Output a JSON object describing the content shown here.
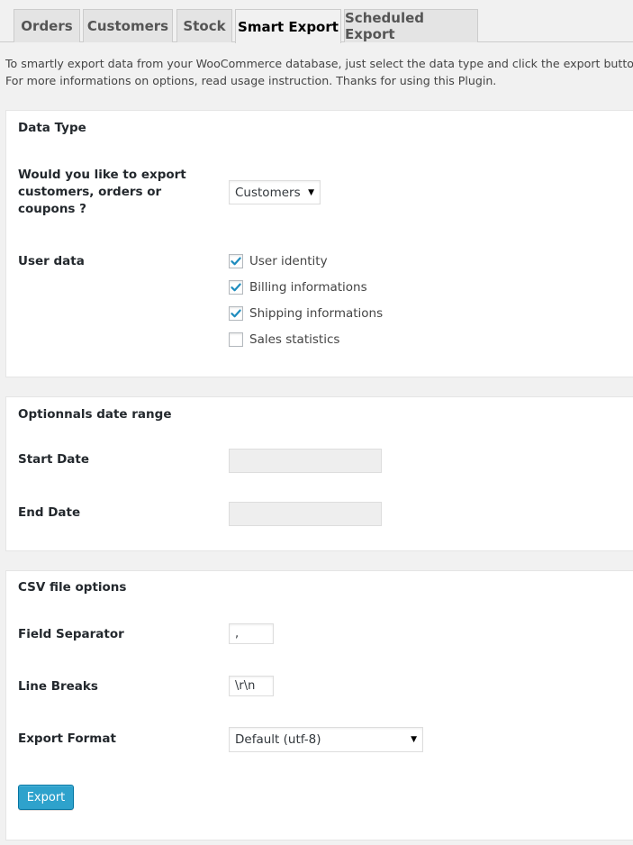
{
  "tabs": [
    {
      "label": "Orders",
      "active": false
    },
    {
      "label": "Customers",
      "active": false
    },
    {
      "label": "Stock",
      "active": false
    },
    {
      "label": "Smart Export",
      "active": true
    },
    {
      "label": "Scheduled Export",
      "active": false
    }
  ],
  "intro": {
    "line1": "To smartly export data from your WooCommerce database, just select the data type and click the export button.",
    "line2": "For more informations on options, read usage instruction. Thanks for using this Plugin."
  },
  "data_type": {
    "title": "Data Type",
    "question_line1": "Would you like to export",
    "question_line2": "customers, orders or",
    "question_line3": "coupons ?",
    "selected": "Customers",
    "user_data_label": "User data",
    "options": [
      {
        "label": "User identity",
        "checked": true
      },
      {
        "label": "Billing informations",
        "checked": true
      },
      {
        "label": "Shipping informations",
        "checked": true
      },
      {
        "label": "Sales statistics",
        "checked": false
      }
    ]
  },
  "date_range": {
    "title": "Optionnals date range",
    "start_label": "Start Date",
    "start_value": "",
    "end_label": "End Date",
    "end_value": ""
  },
  "csv": {
    "title": "CSV file options",
    "separator_label": "Field Separator",
    "separator_value": ",",
    "linebreak_label": "Line Breaks",
    "linebreak_value": "\\r\\n",
    "format_label": "Export Format",
    "format_selected": "Default (utf-8)",
    "export_button": "Export"
  },
  "colors": {
    "accent": "#2ea2cc",
    "check": "#1e8cbe"
  }
}
